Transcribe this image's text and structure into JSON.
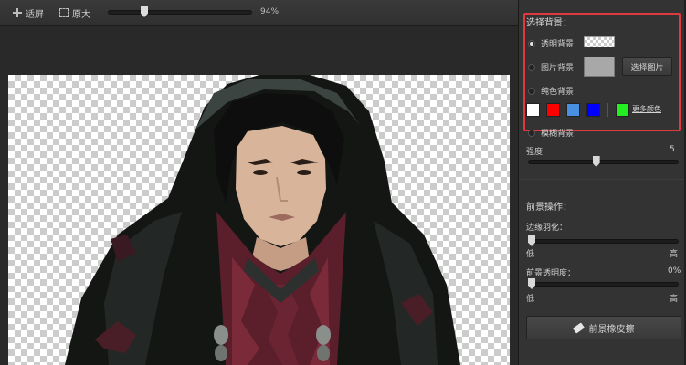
{
  "toolbar": {
    "fit_label": "适屏",
    "original_label": "原大",
    "zoom_value": "94%",
    "zoom_fraction": 0.24
  },
  "panel": {
    "bg_section_title": "选择背景：",
    "bg_options": [
      {
        "label": "透明背景",
        "checked": true
      },
      {
        "label": "图片背景",
        "checked": false
      },
      {
        "label": "纯色背景",
        "checked": false
      },
      {
        "label": "模糊背景",
        "checked": false
      }
    ],
    "select_image_button": "选择图片",
    "colors": [
      "#ffffff",
      "#ff0000",
      "#4a90e2",
      "#0000ff",
      "#22ee22"
    ],
    "more_colors_label": "更多颜色",
    "strength_label": "强度",
    "strength_value": "5",
    "strength_fraction": 0.45,
    "fg_section_title": "前景操作：",
    "edge_feather_label": "边缘羽化：",
    "edge_feather_fraction": 0.0,
    "edge_low": "低",
    "edge_high": "高",
    "fg_opacity_label": "前景透明度：",
    "fg_opacity_value": "0%",
    "fg_opacity_fraction": 0.0,
    "opacity_low": "低",
    "opacity_high": "高",
    "fg_eraser_button": "前景橡皮擦"
  }
}
